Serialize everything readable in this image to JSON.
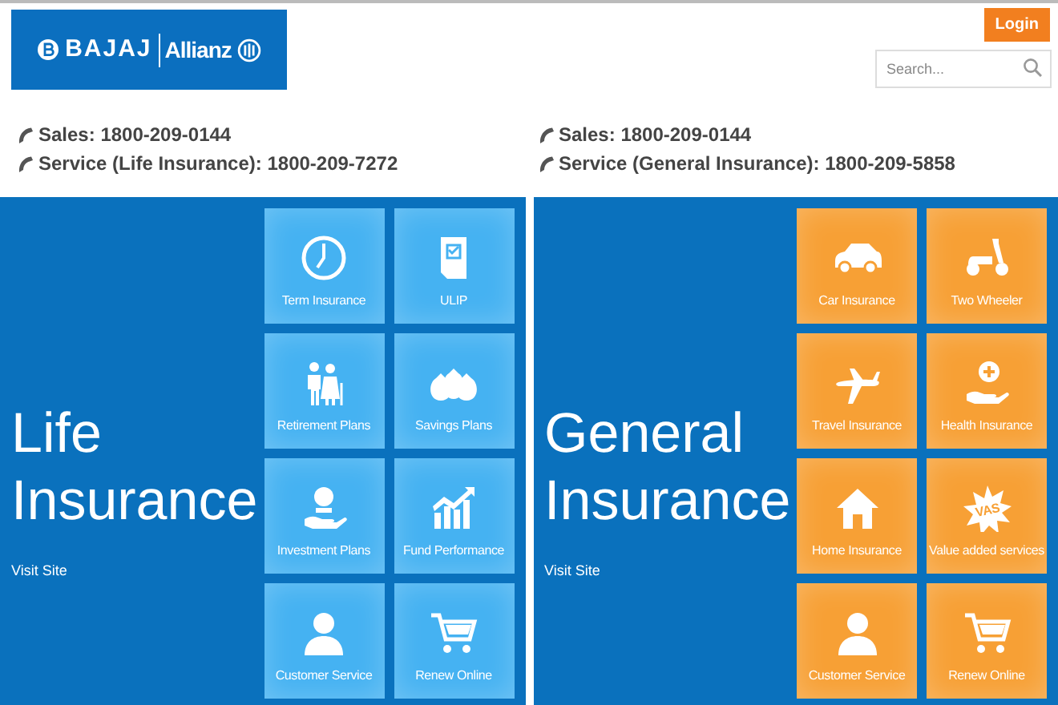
{
  "header": {
    "logo": {
      "brand": "BAJAJ",
      "partner": "Allianz"
    },
    "login_button": "Login",
    "search": {
      "placeholder": "Search..."
    }
  },
  "contacts": [
    {
      "lines": [
        "Sales: 1800-209-0144",
        "Service (Life Insurance): 1800-209-7272"
      ]
    },
    {
      "lines": [
        "Sales: 1800-209-0144",
        "Service (General Insurance): 1800-209-5858"
      ]
    }
  ],
  "panels": [
    {
      "title": "Life Insurance",
      "link": "Visit Site",
      "color": "#45b2f2",
      "tiles": [
        {
          "label": "Term Insurance"
        },
        {
          "label": "ULIP"
        },
        {
          "label": "Retirement Plans"
        },
        {
          "label": "Savings Plans"
        },
        {
          "label": "Investment Plans"
        },
        {
          "label": "Fund Performance"
        },
        {
          "label": "Customer Service"
        },
        {
          "label": "Renew Online"
        }
      ]
    },
    {
      "title": "General Insurance",
      "link": "Visit Site",
      "color": "#f7a035",
      "tiles": [
        {
          "label": "Car Insurance"
        },
        {
          "label": "Two Wheeler"
        },
        {
          "label": "Travel Insurance"
        },
        {
          "label": "Health Insurance"
        },
        {
          "label": "Home Insurance"
        },
        {
          "label": "Value added services",
          "icon_text": "VAS"
        },
        {
          "label": "Customer Service"
        },
        {
          "label": "Renew Online"
        }
      ]
    }
  ]
}
